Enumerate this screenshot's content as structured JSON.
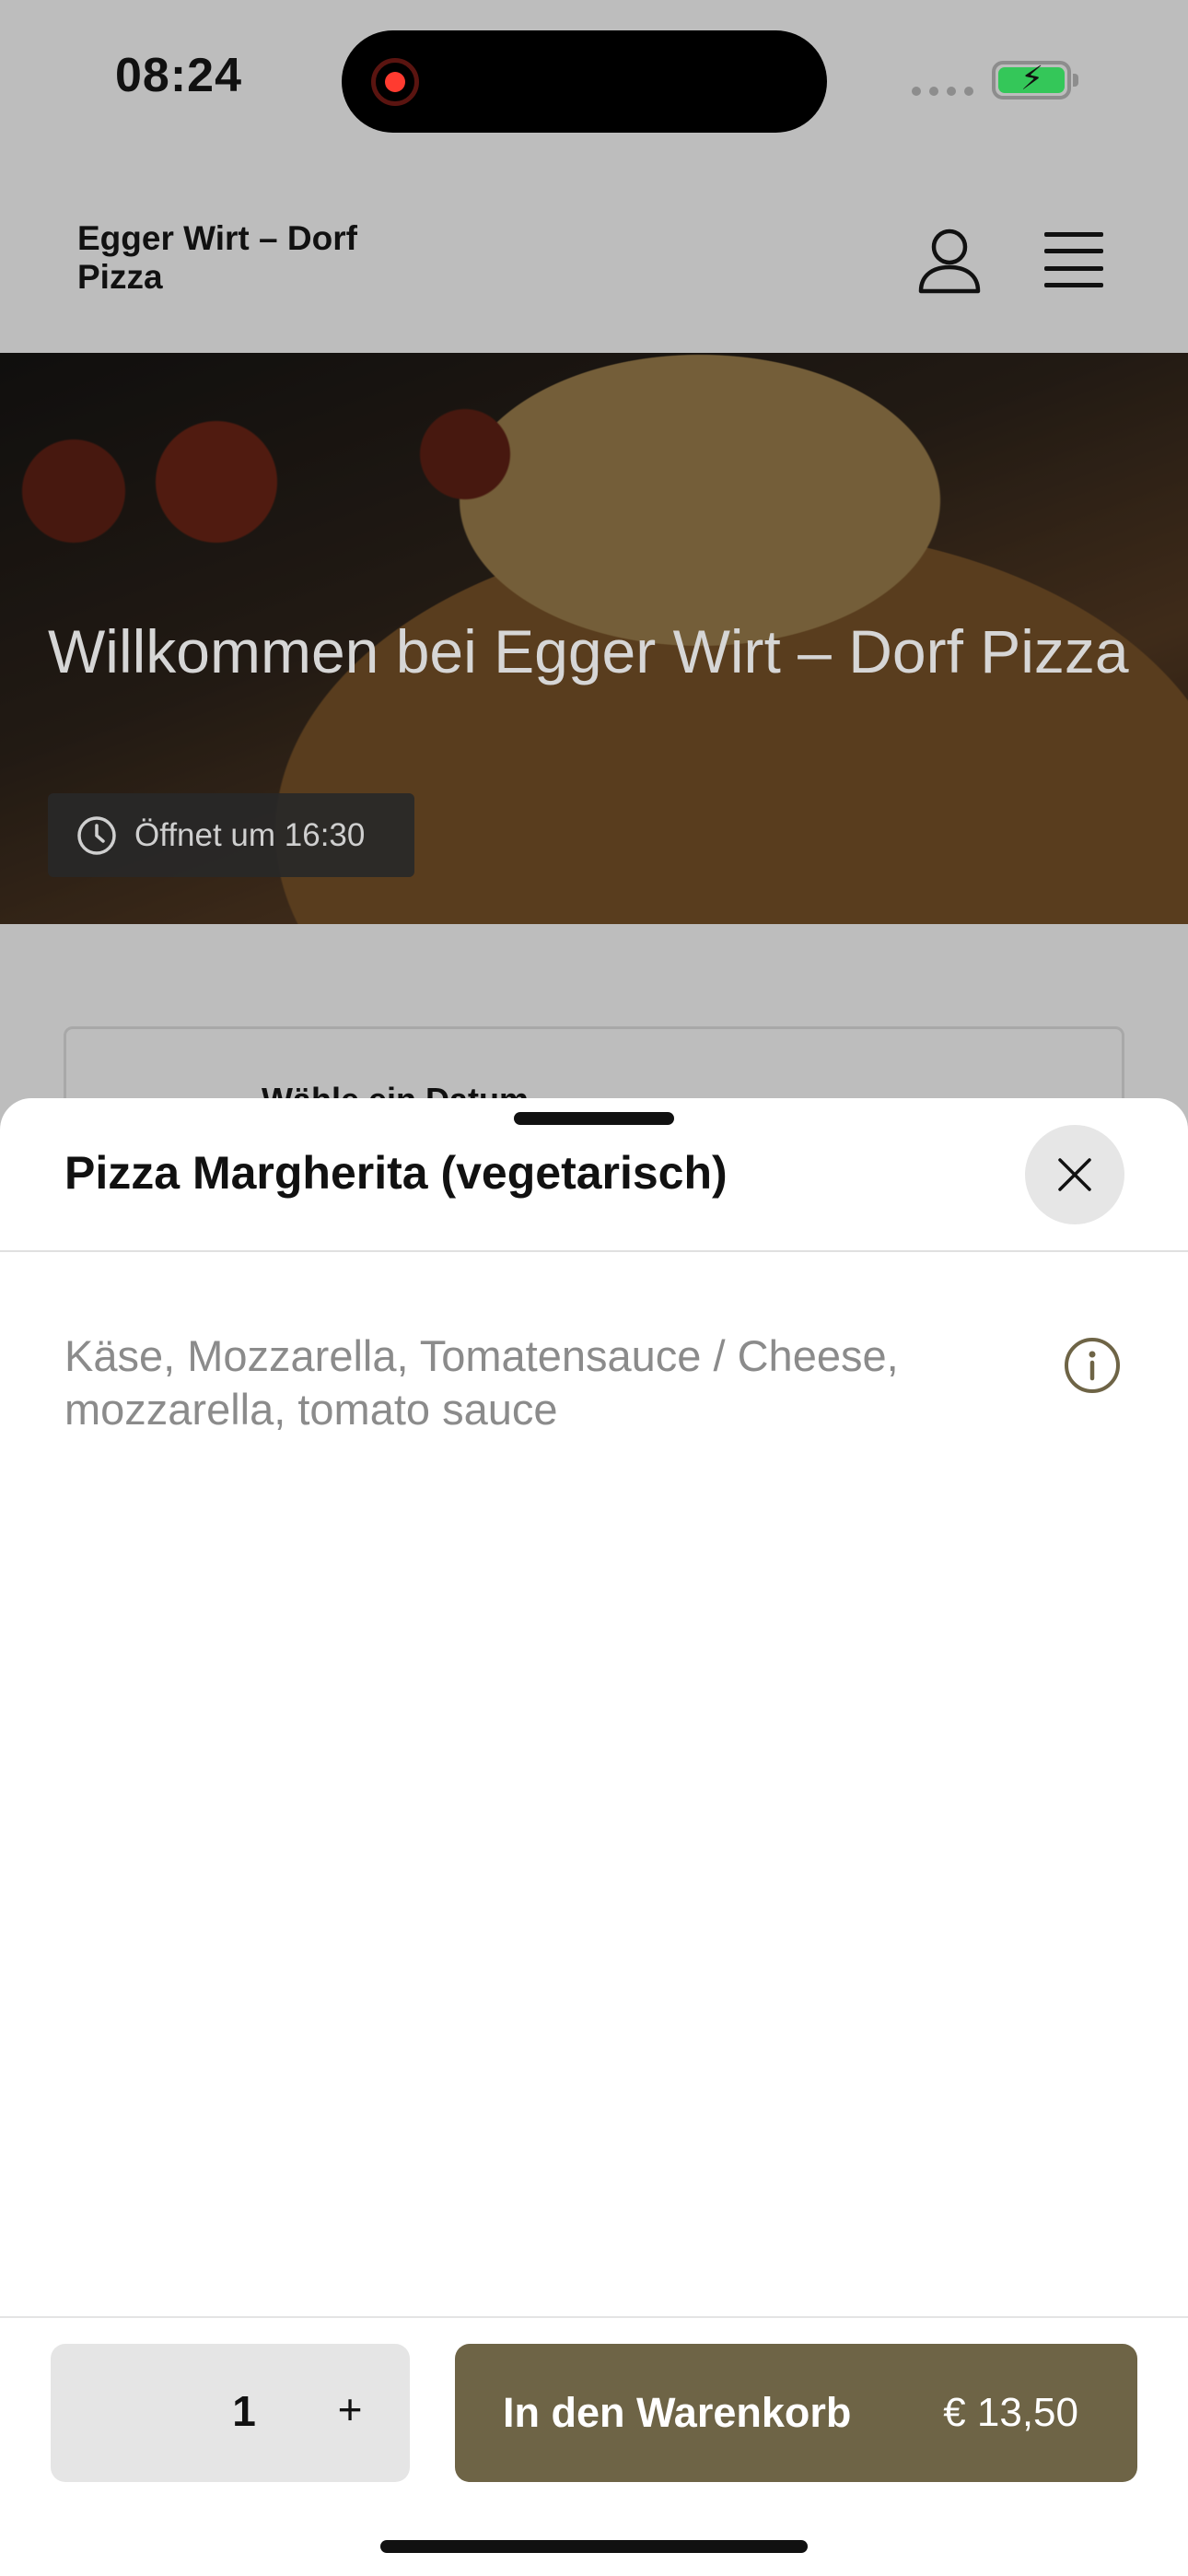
{
  "status_bar": {
    "time": "08:24",
    "recording": true,
    "battery_color": "#34c759"
  },
  "header": {
    "brand": "Egger Wirt – Dorf Pizza",
    "icons": [
      "user-icon",
      "menu-icon"
    ]
  },
  "hero": {
    "title": "Willkommen bei Egger Wirt – Dorf Pizza",
    "open_badge": "Öffnet um 16:30"
  },
  "date_picker": {
    "label": "Wähle ein Datum"
  },
  "sheet": {
    "title": "Pizza Margherita (vegetarisch)",
    "description": "Käse, Mozzarella, Tomatensauce / Cheese, mozzarella, tomato sauce",
    "quantity": "1",
    "plus_label": "+",
    "add_to_cart_label": "In den Warenkorb",
    "price": "€ 13,50",
    "accent_color": "#6e6446"
  }
}
